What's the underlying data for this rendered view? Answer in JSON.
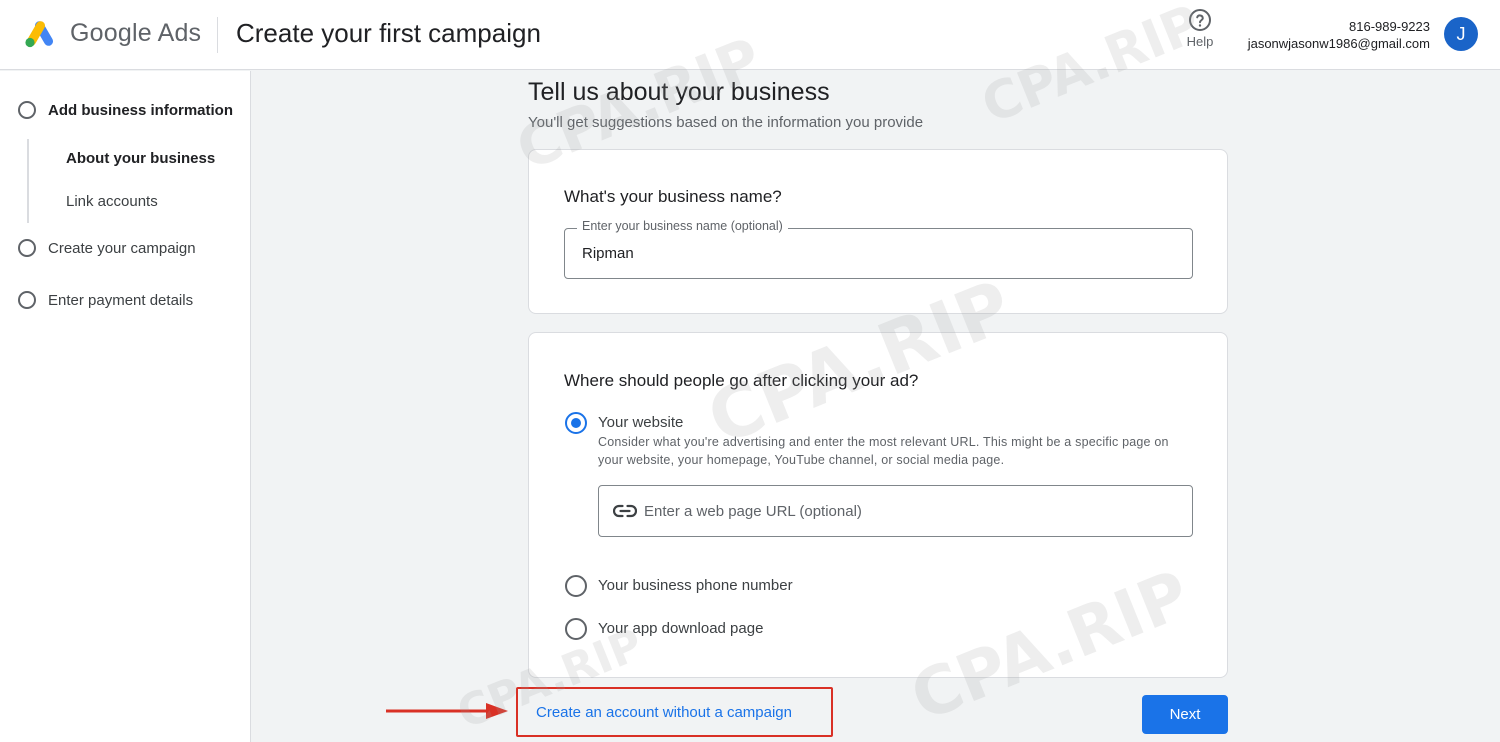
{
  "header": {
    "brand": "Google Ads",
    "title": "Create your first campaign",
    "help_label": "Help",
    "phone": "816-989-9223",
    "email": "jasonwjasonw1986@gmail.com",
    "avatar_letter": "J"
  },
  "sidebar": {
    "steps": [
      {
        "label": "Add business information"
      },
      {
        "label": "Create your campaign"
      },
      {
        "label": "Enter payment details"
      }
    ],
    "substeps": [
      {
        "label": "About your business"
      },
      {
        "label": "Link accounts"
      }
    ]
  },
  "main": {
    "title": "Tell us about your business",
    "subtitle": "You'll get suggestions based on the information you provide",
    "business_name": {
      "question": "What's your business name?",
      "field_label": "Enter your business name (optional)",
      "value": "Ripman"
    },
    "destination": {
      "question": "Where should people go after clicking your ad?",
      "options": [
        {
          "label": "Your website",
          "selected": true
        },
        {
          "label": "Your business phone number",
          "selected": false
        },
        {
          "label": "Your app download page",
          "selected": false
        }
      ],
      "website_desc": "Consider what you're advertising and enter the most relevant URL. This might be a specific page on your website, your homepage, YouTube channel, or social media page.",
      "url_placeholder": "Enter a web page URL (optional)"
    }
  },
  "footer": {
    "create_without_campaign": "Create an account without a campaign",
    "next": "Next"
  },
  "watermark": "CPA.RIP",
  "colors": {
    "primary": "#1a73e8",
    "highlight": "#d93025",
    "avatar": "#1a64c8"
  }
}
